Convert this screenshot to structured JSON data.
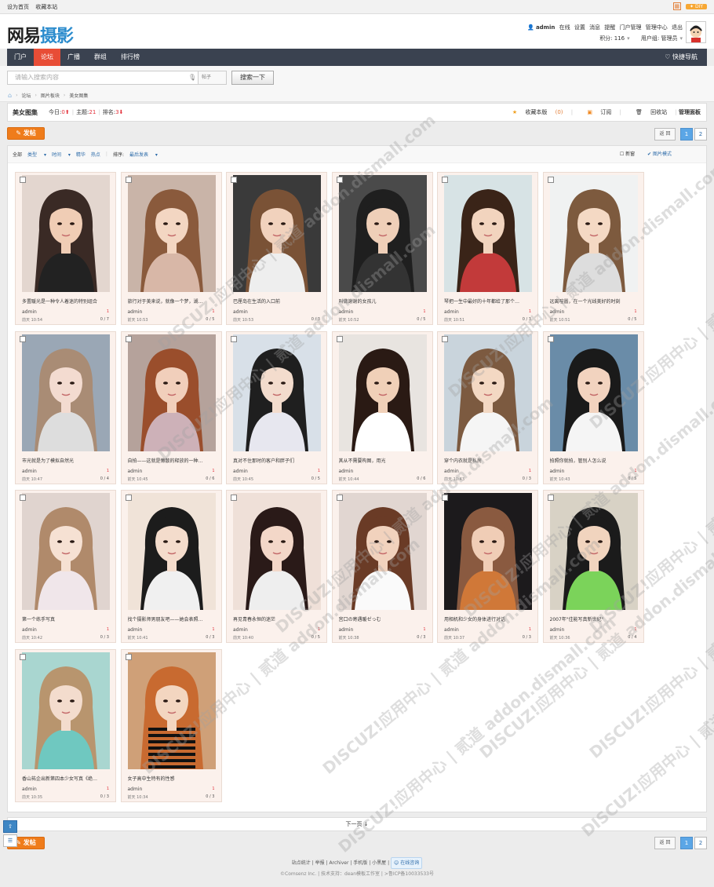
{
  "topbar": {
    "set_home": "设为首页",
    "bookmark": "收藏本站",
    "diy": "DIY"
  },
  "logo": {
    "part1": "网易",
    "part2": "摄影"
  },
  "user": {
    "name": "admin",
    "status": "在线",
    "links": [
      "设置",
      "消息",
      "提醒",
      "门户管理",
      "管理中心",
      "退出"
    ],
    "credits": "积分: 116",
    "group": "用户组: 管理员"
  },
  "nav": {
    "items": [
      "门户",
      "论坛",
      "广播",
      "群组",
      "排行榜"
    ],
    "active_index": 1,
    "quick": "快捷导航"
  },
  "search": {
    "placeholder": "请输入搜索内容",
    "type": "帖子",
    "button": "搜索一下"
  },
  "breadcrumb": [
    "论坛",
    "图片板块",
    "美女图集"
  ],
  "forum": {
    "title": "美女图集",
    "today_label": "今日:",
    "today_value": "0",
    "threads_label": "主题:",
    "threads_value": "21",
    "rank_label": "排名:",
    "rank_value": "3",
    "fav_label": "收藏本版",
    "fav_count": "(0)",
    "rss": "订阅",
    "recycle": "回收站",
    "admin": "管理面板"
  },
  "post_button": "发帖",
  "pager": {
    "back": "返 回",
    "pages": [
      "1",
      "2"
    ],
    "current": "1"
  },
  "filter": {
    "items": [
      "全部",
      "类型",
      "时间",
      "精华",
      "热点"
    ],
    "sort_label": "排序:",
    "sort_value": "最后发表",
    "new_window": "新窗",
    "image_mode": "图片模式"
  },
  "cards": [
    {
      "title": "多置暖光是一种令人着迷的特别组合",
      "author": "admin",
      "time": "前天 10:54",
      "one": "1",
      "replies": "0 / 7"
    },
    {
      "title": "旅行对于美来说，就像一个梦，湖…",
      "author": "admin",
      "time": "前天 10:53",
      "one": "1",
      "replies": "0 / 5"
    },
    {
      "title": "巴厘岛在生活的入口前",
      "author": "admin",
      "time": "前天 10:53",
      "one": "",
      "replies": "0 / 3"
    },
    {
      "title": "叫做谢谢的女孩儿",
      "author": "admin",
      "time": "前天 10:52",
      "one": "1",
      "replies": "0 / 5"
    },
    {
      "title": "琴把一生中最好的十年都给了那个…",
      "author": "admin",
      "time": "前天 10:51",
      "one": "1",
      "replies": "0 / 3"
    },
    {
      "title": "远离喧嚣，在一个光线美好的时刻",
      "author": "admin",
      "time": "前天 10:51",
      "one": "1",
      "replies": "0 / 5"
    },
    {
      "title": "市光就是为了模拟自然光",
      "author": "admin",
      "time": "前天 10:47",
      "one": "1",
      "replies": "0 / 4"
    },
    {
      "title": "自拍——这就是懒散的释放的一种…",
      "author": "admin",
      "time": "前天 10:45",
      "one": "1",
      "replies": "0 / 6"
    },
    {
      "title": "真对不住那时的客户和胖子们",
      "author": "admin",
      "time": "前天 10:45",
      "one": "1",
      "replies": "0 / 5"
    },
    {
      "title": "其从不需要构图，用光",
      "author": "admin",
      "time": "前天 10:44",
      "one": "",
      "replies": "0 / 6"
    },
    {
      "title": "穿个内衣就是私房",
      "author": "admin",
      "time": "前天 10:43",
      "one": "1",
      "replies": "0 / 3"
    },
    {
      "title": "拍照你就拍，管别人怎么说",
      "author": "admin",
      "time": "前天 10:43",
      "one": "1",
      "replies": "0 / 5"
    },
    {
      "title": "第一个练手写真",
      "author": "admin",
      "time": "前天 10:42",
      "one": "1",
      "replies": "0 / 3"
    },
    {
      "title": "找个摄影师男朋友吧——她会表照…",
      "author": "admin",
      "time": "前天 10:41",
      "one": "1",
      "replies": "0 / 3"
    },
    {
      "title": "再见青春永恒的迷茫",
      "author": "admin",
      "time": "前天 10:40",
      "one": "1",
      "replies": "0 / 5"
    },
    {
      "title": "宫口の寄遇暖ゼっむ",
      "author": "admin",
      "time": "前天 10:38",
      "one": "1",
      "replies": "0 / 3"
    },
    {
      "title": "用相机和少女的身体进行对话",
      "author": "admin",
      "time": "前天 10:37",
      "one": "1",
      "replies": "0 / 3"
    },
    {
      "title": "2007年\"佳能写真新世纪\"",
      "author": "admin",
      "time": "前天 10:36",
      "one": "1",
      "replies": "0 / 4"
    },
    {
      "title": "香山祐企出新第四本少女写真《绝…",
      "author": "admin",
      "time": "前天 10:35",
      "one": "1",
      "replies": "0 / 3"
    },
    {
      "title": "女子高中生特有的性感",
      "author": "admin",
      "time": "前天 10:34",
      "one": "1",
      "replies": "0 / 3"
    }
  ],
  "next_page": "下一页 ↓",
  "footer": {
    "links": [
      "站点统计",
      "举报",
      "Archiver",
      "手机版",
      "小黑屋"
    ],
    "online": "在线咨询",
    "copyright": "©Comsenz Inc.  |  技术支持：dean模板工作室  |  >鲁ICP备10033533号"
  },
  "watermark": "DISCUZ!应用中心 | 贰道 addon.dismall.com",
  "colors": {
    "nav_bg": "#3a4250",
    "nav_active": "#e84d36",
    "accent_blue": "#2b6aa8",
    "post_orange": "#ef7c1b",
    "card_bg": "#fbf1ec"
  }
}
